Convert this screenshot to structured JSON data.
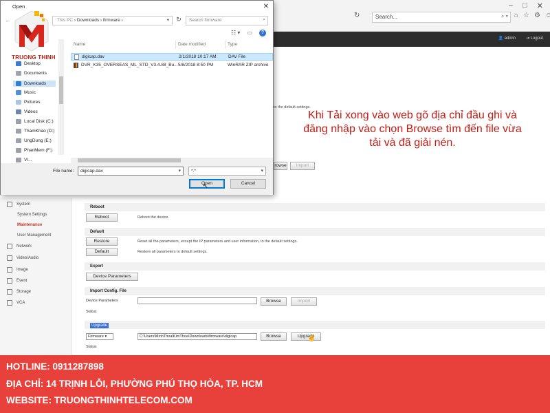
{
  "browser": {
    "search_placeholder": "Search...",
    "window_controls": [
      "–",
      "□",
      "✕"
    ]
  },
  "app": {
    "admin_label": "admin",
    "logout_label": "Logout"
  },
  "left_nav": [
    {
      "label": "System",
      "icon": "system-icon",
      "sub": false,
      "active": false
    },
    {
      "label": "System Settings",
      "icon": "",
      "sub": true,
      "active": false
    },
    {
      "label": "Maintenance",
      "icon": "",
      "sub": true,
      "active": true
    },
    {
      "label": "User Management",
      "icon": "",
      "sub": true,
      "active": false
    },
    {
      "label": "Network",
      "icon": "network-icon",
      "sub": false,
      "active": false
    },
    {
      "label": "Video/Audio",
      "icon": "video-icon",
      "sub": false,
      "active": false
    },
    {
      "label": "Image",
      "icon": "image-icon",
      "sub": false,
      "active": false
    },
    {
      "label": "Event",
      "icon": "event-icon",
      "sub": false,
      "active": false
    },
    {
      "label": "Storage",
      "icon": "storage-icon",
      "sub": false,
      "active": false
    },
    {
      "label": "VCA",
      "icon": "vca-icon",
      "sub": false,
      "active": false
    }
  ],
  "maintenance": {
    "reboot": {
      "header": "Reboot",
      "button": "Reboot",
      "desc": "Reboot the device."
    },
    "default": {
      "header": "Default",
      "restore_button": "Restore",
      "restore_desc": "Reset all the parameters, except the IP parameters and user information, to the default settings.",
      "default_button": "Default",
      "default_desc": "Restore all parameters to default settings."
    },
    "export": {
      "header": "Export",
      "button": "Device Parameters"
    },
    "import": {
      "header": "Import Config. File",
      "label": "Device Parameters",
      "browse": "Browse",
      "import": "Import",
      "status_label": "Status"
    },
    "upgrade": {
      "header": "Upgrade",
      "type": "Firmware",
      "path": "C:\\Users\\MinhThoa\\KimThoa\\Downloads\\firmware\\digicap",
      "browse": "Browse",
      "upgrade": "Upgrade",
      "status_label": "Status"
    }
  },
  "background_fragments": {
    "default_settings": "to the default settings.",
    "browse": "rowse",
    "import": "Import"
  },
  "annotation": "Khi Tải xong vào web gõ địa chỉ đầu ghi và đăng nhập vào chọn Browse tìm đến file vừa tải và đã giải nén.",
  "footer": {
    "hotline": "HOTLINE: 0911287898",
    "address": "ĐỊA CHỈ: 14 TRỊNH LỖI, PHƯỜNG PHÚ THỌ HÒA, TP. HCM",
    "website": "WEBSITE: TRUONGTHINHTELECOM.COM"
  },
  "logo": {
    "text": "TRUONG THINH"
  },
  "dialog": {
    "title": "Open",
    "path_prefix": "This PC",
    "path_parts": [
      "Downloads",
      "firmware"
    ],
    "search_placeholder": "Search firmware",
    "columns": {
      "name": "Name",
      "date": "Date modified",
      "type": "Type"
    },
    "files": [
      {
        "name": "digicap.dav",
        "date": "2/1/2018 10:17 AM",
        "type": "DAV File",
        "selected": true
      },
      {
        "name": "DVR_K35_OVERSEAS_ML_STD_V3.4.88_Bu...",
        "date": "5/8/2018 8:50 PM",
        "type": "WinRAR ZIP archive",
        "selected": false
      }
    ],
    "sidebar": [
      {
        "label": "Desktop",
        "color": "#3b7bd6"
      },
      {
        "label": "Documents",
        "color": "#9aa6b5"
      },
      {
        "label": "Downloads",
        "color": "#2f7fd8"
      },
      {
        "label": "Music",
        "color": "#4f90d9"
      },
      {
        "label": "Pictures",
        "color": "#a8c4e0"
      },
      {
        "label": "Videos",
        "color": "#6b87ad"
      },
      {
        "label": "Local Disk (C:)",
        "color": "#9aa1a8"
      },
      {
        "label": "ThamKhao (D:)",
        "color": "#9aa1a8"
      },
      {
        "label": "UngDung (E:)",
        "color": "#9aa1a8"
      },
      {
        "label": "PhanMem (F:)",
        "color": "#9aa1a8"
      },
      {
        "label": "VI...",
        "color": "#9aa1a8"
      }
    ],
    "selected_sidebar": "Downloads",
    "file_name_label": "File name:",
    "file_name_value": "digicap.dav",
    "file_type_value": "*.*",
    "open_button": "Open",
    "cancel_button": "Cancel"
  },
  "colors": {
    "footer_bg": "#e8403b",
    "annotation": "#c31b12",
    "active_nav": "#c0392b",
    "selection": "#cce8ff"
  }
}
